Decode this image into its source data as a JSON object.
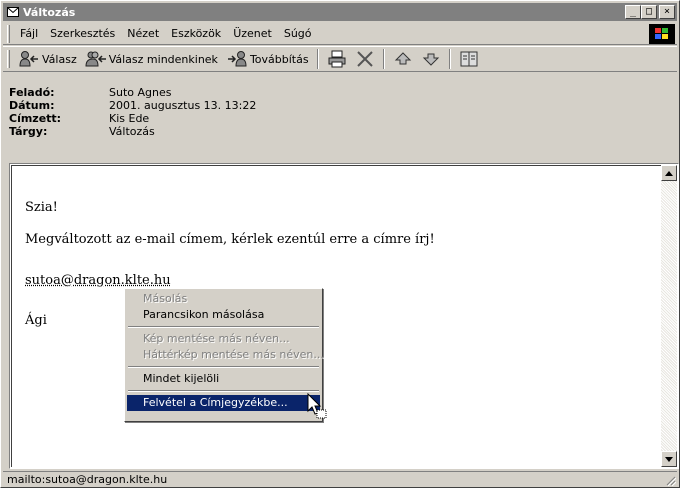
{
  "window": {
    "title": "Változás",
    "icon": "envelope-icon",
    "controls": {
      "minimize": "_",
      "maximize": "□",
      "close": "×"
    }
  },
  "menubar": {
    "items": [
      "Fájl",
      "Szerkesztés",
      "Nézet",
      "Eszközök",
      "Üzenet",
      "Súgó"
    ]
  },
  "toolbar": {
    "reply": "Válasz",
    "reply_all": "Válasz mindenkinek",
    "forward": "Továbbítás",
    "icons": [
      "print-icon",
      "delete-icon",
      "previous-icon",
      "next-icon",
      "address-book-icon"
    ]
  },
  "header": {
    "from_label": "Feladó:",
    "from": "Suto Agnes",
    "date_label": "Dátum:",
    "date": "2001. augusztus 13. 13:22",
    "to_label": "Címzett:",
    "to": "Kis Ede",
    "subject_label": "Tárgy:",
    "subject": "Változás"
  },
  "message": {
    "greeting": "Szia!",
    "line": "Megváltozott az e-mail címem, kérlek ezentúl erre a címre írj!",
    "link": "sutoa@dragon.klte.hu",
    "signature": "Ági"
  },
  "context_menu": {
    "copy": "Másolás",
    "copy_shortcut": "Parancsikon másolása",
    "save_image": "Kép mentése más néven...",
    "save_background": "Háttérkép mentése más néven...",
    "select_all": "Mindet kijelöli",
    "add_contact": "Felvétel a Címjegyzékbe..."
  },
  "status": {
    "text": "mailto:sutoa@dragon.klte.hu"
  }
}
